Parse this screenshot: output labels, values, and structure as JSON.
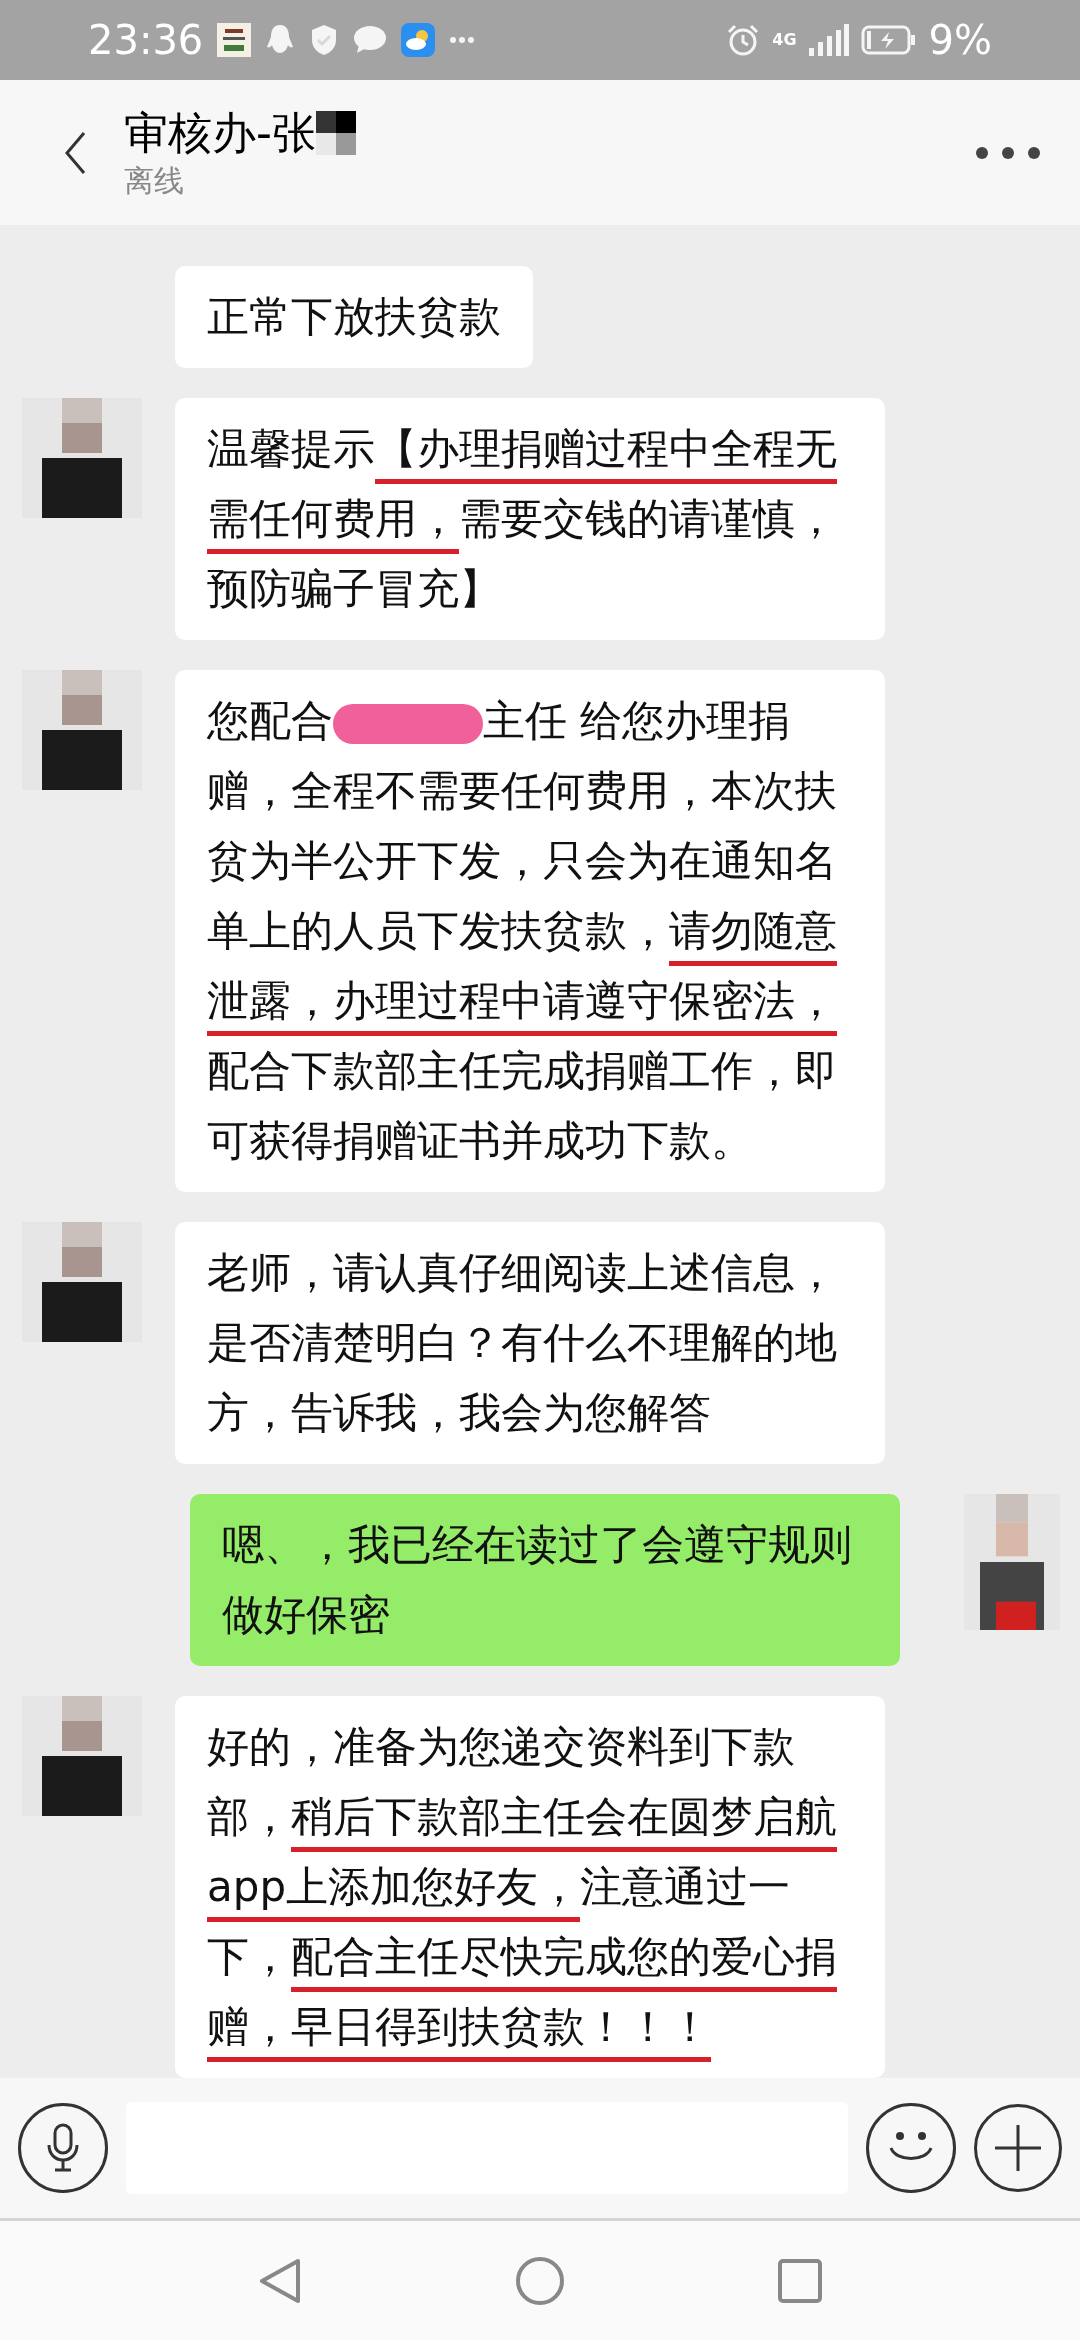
{
  "status_bar": {
    "time": "23:36",
    "network": "4G",
    "battery": "9%"
  },
  "header": {
    "title": "审核办-张",
    "status": "离线"
  },
  "messages": [
    {
      "kind": "incoming",
      "avatar": false,
      "segments": [
        {
          "kind": "text",
          "text": "正常下放扶贫款",
          "underlined": false
        }
      ]
    },
    {
      "kind": "incoming",
      "avatar": true,
      "segments": [
        {
          "kind": "text",
          "text": "温馨提示",
          "underlined": false
        },
        {
          "kind": "text",
          "text": "【办理捐赠过程中全程无需任何费用，",
          "underlined": true
        },
        {
          "kind": "text",
          "text": "需要交钱的请谨慎，预防骗子冒充】",
          "underlined": false
        }
      ]
    },
    {
      "kind": "incoming",
      "avatar": true,
      "segments": [
        {
          "kind": "text",
          "text": "您配合",
          "underlined": false
        },
        {
          "kind": "redaction"
        },
        {
          "kind": "text",
          "text": "主任 给您办理捐赠，全程不需要任何费用，本次扶贫为半公开下发，只会为在通知名单上的人员下发扶贫款，",
          "underlined": false
        },
        {
          "kind": "text",
          "text": "请勿随意泄露，办理过程中请遵守保密法，",
          "underlined": true
        },
        {
          "kind": "text",
          "text": "配合下款部主任完成捐赠工作，即可获得捐赠证书并成功下款。",
          "underlined": false
        }
      ]
    },
    {
      "kind": "incoming",
      "avatar": true,
      "segments": [
        {
          "kind": "text",
          "text": "老师，请认真仔细阅读上述信息，是否清楚明白？有什么不理解的地方，告诉我，我会为您解答",
          "underlined": false
        }
      ]
    },
    {
      "kind": "outgoing",
      "avatar": true,
      "segments": [
        {
          "kind": "text",
          "text": "嗯、，我已经在读过了会遵守规则做好保密",
          "underlined": false
        }
      ]
    },
    {
      "kind": "incoming",
      "avatar": true,
      "segments": [
        {
          "kind": "text",
          "text": "好的，准备为您递交资料到下款部，",
          "underlined": false
        },
        {
          "kind": "text",
          "text": "稍后下款部主任会在圆梦启航app上添加您好友，",
          "underlined": true
        },
        {
          "kind": "text",
          "text": "注意通过一下，",
          "underlined": false
        },
        {
          "kind": "text",
          "text": "配合主任尽快完成您的爱心捐赠，早日得到扶贫款！！！",
          "underlined": true
        }
      ]
    }
  ]
}
